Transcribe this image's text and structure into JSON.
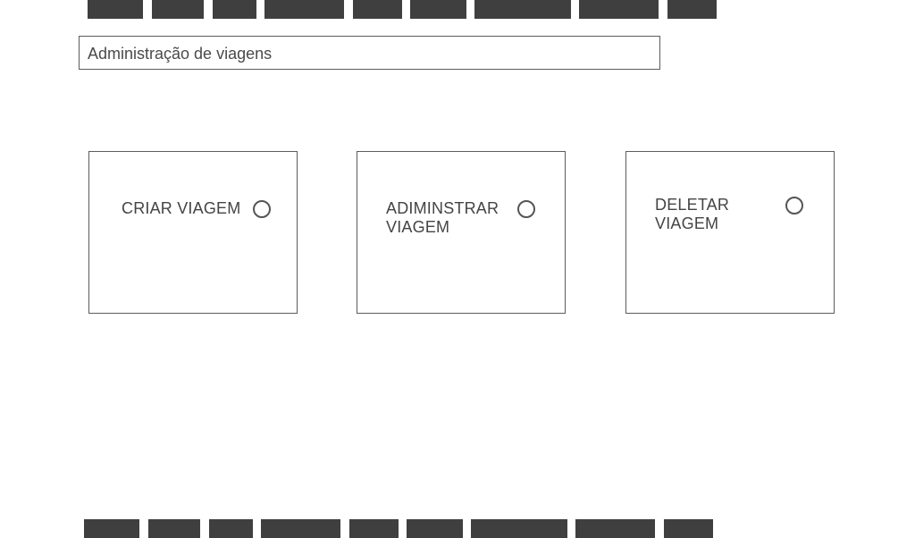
{
  "app": {
    "title": "Administração de viagens"
  },
  "top_nav": {
    "items": [
      "",
      "",
      "",
      "",
      "",
      "",
      "",
      "",
      ""
    ]
  },
  "bottom_nav": {
    "items": [
      "",
      "",
      "",
      "",
      "",
      "",
      "",
      "",
      ""
    ]
  },
  "cards": [
    {
      "label": "CRIAR VIAGEM",
      "selected": false
    },
    {
      "label": "ADIMINSTRAR VIAGEM",
      "selected": false
    },
    {
      "label": "DELETAR VIAGEM",
      "selected": false
    }
  ],
  "colors": {
    "nav_block": "#3f3f3f",
    "border": "#5c5c5c",
    "text": "#444444",
    "background": "#ffffff"
  },
  "icons": {
    "radio": "radio-unselected-icon"
  }
}
